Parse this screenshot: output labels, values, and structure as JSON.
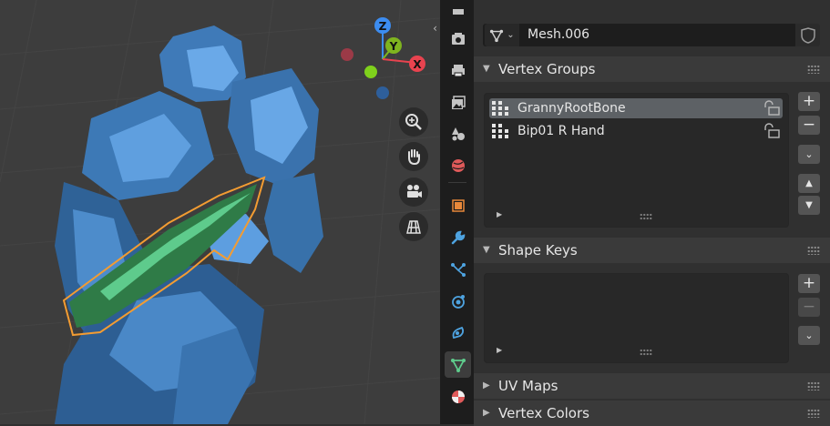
{
  "viewport": {
    "gizmo": {
      "z_label": "Z",
      "y_label": "Y",
      "x_label": "X"
    },
    "nav_tools": [
      "zoom-icon",
      "hand-pan-icon",
      "camera-view-icon",
      "grid-ortho-icon"
    ]
  },
  "tabs": [
    {
      "name": "tool-tab",
      "icon": "tool-icon",
      "active": false
    },
    {
      "name": "render-tab",
      "icon": "camera-render-icon",
      "active": false
    },
    {
      "name": "output-tab",
      "icon": "printer-output-icon",
      "active": false
    },
    {
      "name": "view-layer-tab",
      "icon": "image-layer-icon",
      "active": false
    },
    {
      "name": "scene-tab",
      "icon": "scene-icon",
      "active": false
    },
    {
      "name": "world-tab",
      "icon": "world-icon",
      "active": false
    },
    {
      "name": "object-tab",
      "icon": "object-square-icon",
      "active": false
    },
    {
      "name": "modifier-tab",
      "icon": "wrench-icon",
      "active": false
    },
    {
      "name": "particles-tab",
      "icon": "particles-icon",
      "active": false
    },
    {
      "name": "physics-tab",
      "icon": "physics-icon",
      "active": false
    },
    {
      "name": "constraints-tab",
      "icon": "constraint-icon",
      "active": false
    },
    {
      "name": "data-tab",
      "icon": "mesh-data-icon",
      "active": true
    },
    {
      "name": "material-tab",
      "icon": "material-sphere-icon",
      "active": false
    }
  ],
  "properties": {
    "mesh_name": "Mesh.006",
    "sections": {
      "vertex_groups": {
        "title": "Vertex Groups",
        "items": [
          {
            "label": "GrannyRootBone",
            "selected": true
          },
          {
            "label": "Bip01 R Hand",
            "selected": false
          }
        ]
      },
      "shape_keys": {
        "title": "Shape Keys",
        "items": []
      },
      "uv_maps": {
        "title": "UV Maps"
      },
      "vertex_colors": {
        "title": "Vertex Colors"
      }
    },
    "buttons": {
      "add": "+",
      "remove": "−",
      "specials": "⌄",
      "move_up": "▲",
      "move_down": "▼"
    },
    "arrows": {
      "expanded": "▼",
      "collapsed": "▶"
    }
  },
  "colors": {
    "accent_selected": "#5d6165",
    "mesh_green": "#5ecb8c",
    "selection_outline": "#f39c32",
    "axis_x": "#e8434f",
    "axis_y": "#7fb41f",
    "axis_z": "#3c8cf0"
  }
}
